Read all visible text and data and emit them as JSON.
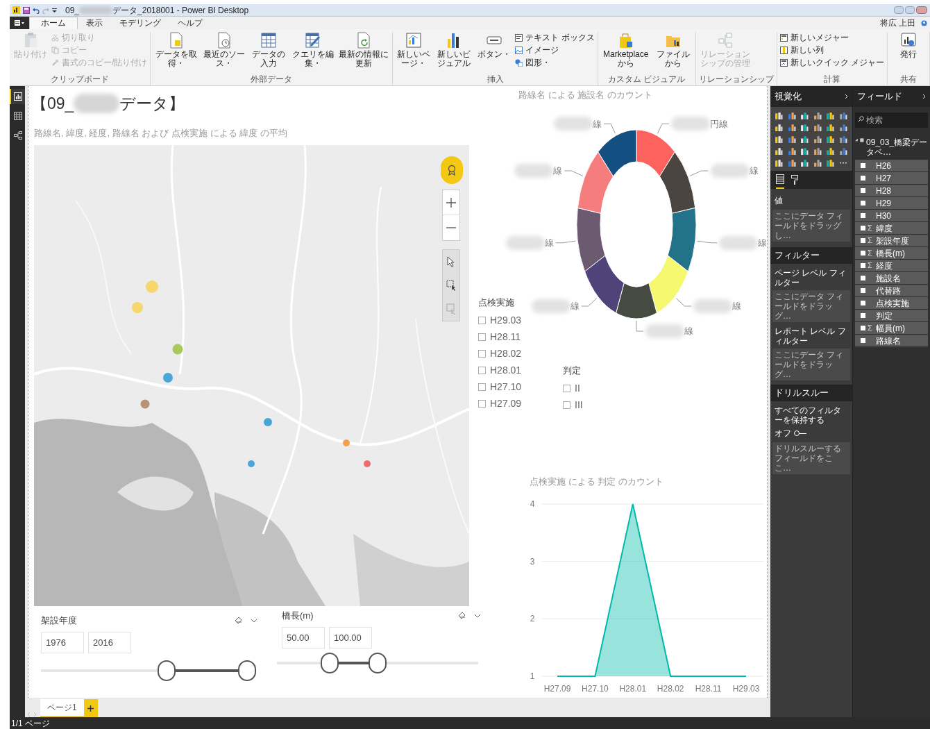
{
  "window": {
    "title_start": "09_",
    "title_end": "データ_2018001 - Power BI Desktop",
    "user": "将広 上田"
  },
  "ribbon_tabs": [
    {
      "label": "ホーム",
      "selected": true
    },
    {
      "label": "表示",
      "selected": false
    },
    {
      "label": "モデリング",
      "selected": false
    },
    {
      "label": "ヘルプ",
      "selected": false
    }
  ],
  "ribbon_groups": [
    {
      "label": "クリップボード",
      "items": [
        {
          "label": "貼り付け",
          "kind": "large",
          "disabled": true
        },
        {
          "label": "切り取り",
          "kind": "small",
          "disabled": true
        },
        {
          "label": "コピー",
          "kind": "small",
          "disabled": true
        },
        {
          "label": "書式のコピー/貼り付け",
          "kind": "small",
          "disabled": true
        }
      ]
    },
    {
      "label": "外部データ",
      "items": [
        {
          "label": "データを取得・",
          "kind": "large",
          "disabled": false
        },
        {
          "label": "最近のソース・",
          "kind": "large",
          "disabled": false
        },
        {
          "label": "データの入力",
          "kind": "large",
          "disabled": false
        },
        {
          "label": "クエリを編集・",
          "kind": "large",
          "disabled": false
        },
        {
          "label": "最新の情報に更新",
          "kind": "large",
          "disabled": false
        }
      ]
    },
    {
      "label": "挿入",
      "items": [
        {
          "label": "新しいページ・",
          "kind": "large",
          "disabled": false
        },
        {
          "label": "新しいビジュアル",
          "kind": "large",
          "disabled": false
        },
        {
          "label": "ボタン・",
          "kind": "large",
          "disabled": false
        },
        {
          "label": "テキスト ボックス",
          "kind": "small",
          "disabled": false
        },
        {
          "label": "イメージ",
          "kind": "small",
          "disabled": false
        },
        {
          "label": "図形・",
          "kind": "small",
          "disabled": false
        }
      ]
    },
    {
      "label": "カスタム ビジュアル",
      "items": [
        {
          "label": "Marketplace から",
          "kind": "large",
          "disabled": false
        },
        {
          "label": "ファイルから",
          "kind": "large",
          "disabled": false
        }
      ]
    },
    {
      "label": "リレーションシップ",
      "items": [
        {
          "label": "リレーションシップの管理",
          "kind": "large",
          "disabled": true
        }
      ]
    },
    {
      "label": "計算",
      "items": [
        {
          "label": "新しいメジャー",
          "kind": "small",
          "disabled": false
        },
        {
          "label": "新しい列",
          "kind": "small",
          "disabled": false
        },
        {
          "label": "新しいクイック メジャー",
          "kind": "small",
          "disabled": false
        }
      ]
    },
    {
      "label": "共有",
      "items": [
        {
          "label": "発行",
          "kind": "large",
          "disabled": false
        }
      ]
    }
  ],
  "views": [
    {
      "selected": true
    },
    {
      "selected": false
    },
    {
      "selected": false
    }
  ],
  "report": {
    "title_start": "【09_",
    "title_end": "データ】"
  },
  "map": {
    "title": "路線名, 緯度, 経度, 路線名 および 点検実施 による 緯度 の平均",
    "points": [
      {
        "color": "#f5d76e"
      },
      {
        "color": "#f5d76e"
      },
      {
        "color": "#a9c95c"
      },
      {
        "color": "#4ba6d8"
      },
      {
        "color": "#b89272"
      },
      {
        "color": "#4ba6d8"
      },
      {
        "color": "#f2a04b"
      },
      {
        "color": "#4ba6d8"
      },
      {
        "color": "#ef6b6b"
      }
    ]
  },
  "range_slicers": [
    {
      "title": "架設年度",
      "low": "1976",
      "high": "2016",
      "thumbs": [
        {
          "level": 0.59
        },
        {
          "level": 1
        }
      ]
    },
    {
      "title": "橋長(m)",
      "low": "50.00",
      "high": "100.00",
      "thumbs": [
        {
          "level": 0.24
        },
        {
          "level": 0.5
        }
      ]
    }
  ],
  "list_slicers": [
    {
      "title": "点検実施",
      "items": [
        {
          "label": "H29.03",
          "checked": false
        },
        {
          "label": "H28.11",
          "checked": false
        },
        {
          "label": "H28.02",
          "checked": false
        },
        {
          "label": "H28.01",
          "checked": false
        },
        {
          "label": "H27.10",
          "checked": false
        },
        {
          "label": "H27.09",
          "checked": false
        }
      ]
    },
    {
      "title": "判定",
      "items": [
        {
          "label": "II",
          "checked": false
        },
        {
          "label": "III",
          "checked": false
        }
      ]
    }
  ],
  "donut": {
    "title": "路線名 による 施設名 のカウント",
    "segments": [
      {
        "label": "円線",
        "color": "#fd625e"
      },
      {
        "label": "線",
        "color": "#4b4541"
      },
      {
        "label": "線",
        "color": "#22728a"
      },
      {
        "label": "線",
        "color": "#f6f870"
      },
      {
        "label": "線",
        "color": "#454b40"
      },
      {
        "label": "線",
        "color": "#4e4479"
      },
      {
        "label": "線",
        "color": "#6c5b70"
      },
      {
        "label": "線",
        "color": "#f57d7d"
      },
      {
        "label": "線",
        "color": "#134f80"
      }
    ]
  },
  "area_chart": {
    "chart_data": {
      "type": "area",
      "title": "点検実施 による 判定 のカウント",
      "categories": [
        "H27.09",
        "H27.10",
        "H28.01",
        "H28.02",
        "H28.11",
        "H29.03"
      ],
      "series": [
        {
          "color": "#01b8aa",
          "values": [
            1,
            1,
            4,
            1,
            1,
            1
          ]
        }
      ],
      "ylim": [
        1,
        4
      ],
      "yticks": [
        1,
        2,
        3,
        4
      ]
    }
  },
  "visualizations": {
    "title": "視覚化",
    "values_label": "値",
    "values_drop": "ここにデータ フィールドをドラッグし…",
    "filters_title": "フィルター",
    "page_filters": "ページ レベル フィルター",
    "page_drop": "ここにデータ フィールドをドラッグ…",
    "report_filters": "レポート レベル フィルター",
    "report_drop": "ここにデータ フィールドをドラッグ…",
    "drill_title": "ドリルスルー",
    "keep_filters": "すべてのフィルターを保持する",
    "toggle": {
      "label": "オフ",
      "on": false
    },
    "drill_drop": "ドリルスルーするフィールドをここ…"
  },
  "fields": {
    "title": "フィールド",
    "search_placeholder": "検索",
    "table": {
      "name": "09_03_橋梁データベ…",
      "expanded": true,
      "columns": [
        {
          "name": "H26",
          "checked": false
        },
        {
          "name": "H27",
          "checked": false
        },
        {
          "name": "H28",
          "checked": false
        },
        {
          "name": "H29",
          "checked": false
        },
        {
          "name": "H30",
          "checked": false
        },
        {
          "name": "緯度",
          "marker": "Σ",
          "checked": false
        },
        {
          "name": "架設年度",
          "marker": "Σ",
          "checked": false
        },
        {
          "name": "橋長(m)",
          "marker": "Σ",
          "checked": false
        },
        {
          "name": "経度",
          "marker": "Σ",
          "checked": false
        },
        {
          "name": "施設名",
          "checked": false
        },
        {
          "name": "代替路",
          "checked": false
        },
        {
          "name": "点検実施",
          "checked": false
        },
        {
          "name": "判定",
          "checked": false
        },
        {
          "name": "幅員(m)",
          "marker": "Σ",
          "checked": false
        },
        {
          "name": "路線名",
          "checked": false
        }
      ]
    }
  },
  "pages": [
    {
      "label": "ページ1",
      "selected": true
    }
  ],
  "status_bar": "1/1 ページ"
}
